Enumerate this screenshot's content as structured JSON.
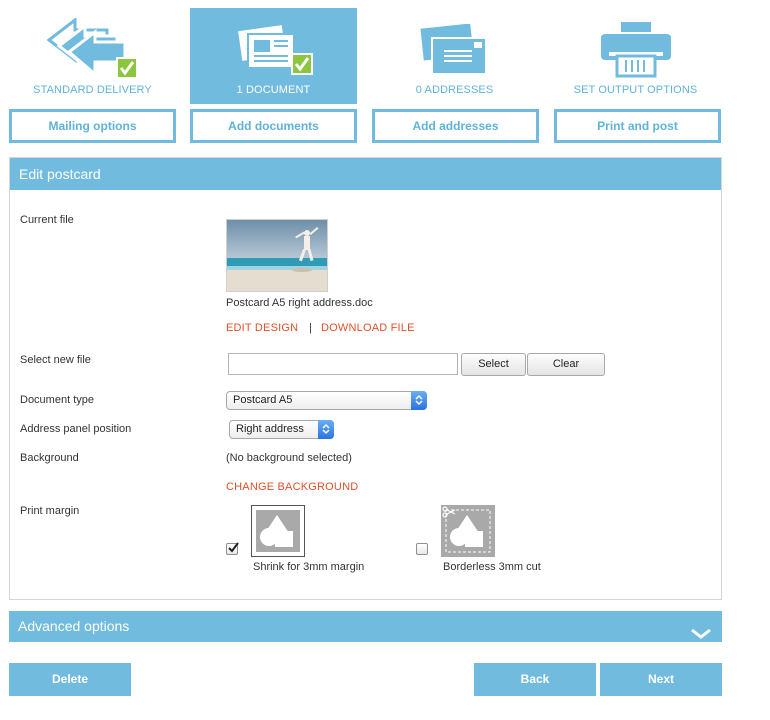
{
  "steps": [
    {
      "label": "STANDARD DELIVERY",
      "icon": "delivery-arrow-icon"
    },
    {
      "label": "1 DOCUMENT",
      "icon": "documents-icon"
    },
    {
      "label": "0 ADDRESSES",
      "icon": "envelopes-icon"
    },
    {
      "label": "SET OUTPUT OPTIONS",
      "icon": "printer-icon"
    }
  ],
  "step_buttons": [
    "Mailing options",
    "Add documents",
    "Add addresses",
    "Print and post"
  ],
  "panel": {
    "title": "Edit postcard",
    "current_file_label": "Current file",
    "file_name": "Postcard A5 right address.doc",
    "edit_design": "EDIT DESIGN",
    "separator": "|",
    "download_file": "DOWNLOAD FILE",
    "select_new_file_label": "Select new file",
    "file_input_value": "",
    "select_button": "Select",
    "clear_button": "Clear",
    "document_type_label": "Document type",
    "document_type_value": "Postcard A5",
    "address_panel_label": "Address panel position",
    "address_panel_value": "Right address",
    "background_label": "Background",
    "background_value": "(No background selected)",
    "change_background": "CHANGE BACKGROUND",
    "print_margin_label": "Print margin",
    "shrink_label": "Shrink for 3mm margin",
    "shrink_checked": true,
    "borderless_label": "Borderless 3mm cut",
    "borderless_checked": false
  },
  "advanced_options": "Advanced options",
  "buttons": {
    "delete": "Delete",
    "back": "Back",
    "next": "Next"
  },
  "colors": {
    "accent": "#71bbdf",
    "link": "#e0502a",
    "check_green": "#8cc63f"
  }
}
